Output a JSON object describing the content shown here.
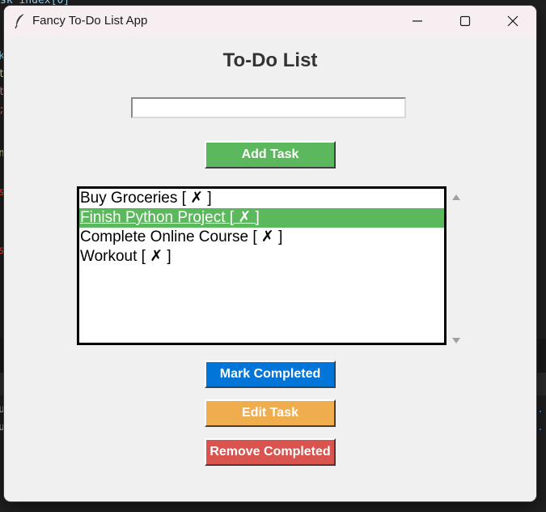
{
  "window": {
    "title": "Fancy To-Do List App",
    "colors": {
      "titlebar": "#f7eef2",
      "body": "#f0f0f0"
    }
  },
  "background": {
    "top_text": "sk_index[0]"
  },
  "app": {
    "heading": "To-Do List",
    "task_input": {
      "value": "",
      "placeholder": ""
    },
    "buttons": {
      "add": {
        "label": "Add Task",
        "color": "#5cb85c"
      },
      "mark": {
        "label": "Mark Completed",
        "color": "#0275d8"
      },
      "edit": {
        "label": "Edit Task",
        "color": "#f0ad4e"
      },
      "remove": {
        "label": "Remove Completed",
        "color": "#d9534f"
      }
    },
    "tasks": [
      {
        "label": "Buy Groceries [ ✗ ]",
        "selected": false
      },
      {
        "label": "Finish Python Project [ ✗ ]",
        "selected": true
      },
      {
        "label": "Complete Online Course [ ✗ ]",
        "selected": false
      },
      {
        "label": "Workout [ ✗ ]",
        "selected": false
      }
    ],
    "selection_color": "#5cb85c"
  },
  "icons": {
    "app_icon": "feather-icon",
    "minimize": "minimize-icon",
    "maximize": "maximize-icon",
    "close": "close-icon",
    "scroll_up": "arrow-up-icon",
    "scroll_down": "arrow-down-icon"
  }
}
